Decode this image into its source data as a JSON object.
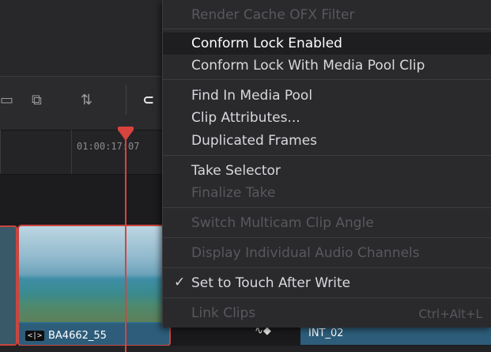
{
  "timeline": {
    "timecode": "01:00:17:07",
    "clips": [
      {
        "name": "BA4662_55",
        "badge": "<|>"
      },
      {
        "name": "INT_02"
      }
    ]
  },
  "context_menu": {
    "items": [
      {
        "label": "Render Cache OFX Filter",
        "enabled": false
      },
      {
        "label": "Conform Lock Enabled",
        "enabled": true,
        "highlighted": true
      },
      {
        "label": "Conform Lock With Media Pool Clip",
        "enabled": true
      },
      {
        "label": "Find In Media Pool",
        "enabled": true
      },
      {
        "label": "Clip Attributes...",
        "enabled": true
      },
      {
        "label": "Duplicated Frames",
        "enabled": true
      },
      {
        "label": "Take Selector",
        "enabled": true
      },
      {
        "label": "Finalize Take",
        "enabled": false
      },
      {
        "label": "Switch Multicam Clip Angle",
        "enabled": false
      },
      {
        "label": "Display Individual Audio Channels",
        "enabled": false
      },
      {
        "label": "Set to Touch After Write",
        "enabled": true,
        "checked": true,
        "check_glyph": "✓"
      },
      {
        "label": "Link Clips",
        "enabled": false,
        "shortcut": "Ctrl+Alt+L"
      }
    ]
  },
  "colors": {
    "playhead": "#d8433e",
    "selection_border": "#c9453f",
    "clip_bar": "#2d5d7a"
  }
}
